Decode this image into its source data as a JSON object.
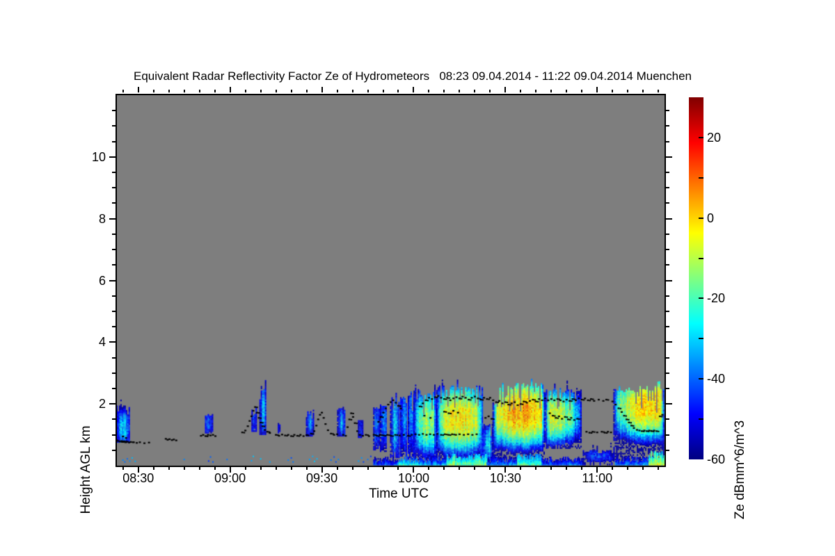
{
  "title": "Equivalent Radar Reflectivity Factor Ze of Hydrometeors   08:23 09.04.2014 - 11:22 09.04.2014 Muenchen",
  "chart_data": {
    "type": "heatmap",
    "title": "Equivalent Radar Reflectivity Factor Ze of Hydrometeors   08:23 09.04.2014 - 11:22 09.04.2014 Muenchen",
    "xlabel": "Time UTC",
    "ylabel": "Height AGL km",
    "time_start": "08:23",
    "time_end": "11:22",
    "x_minutes_total": 179,
    "x_major_ticks": [
      {
        "t": 7,
        "label": "08:30"
      },
      {
        "t": 37,
        "label": "09:00"
      },
      {
        "t": 67,
        "label": "09:30"
      },
      {
        "t": 97,
        "label": "10:00"
      },
      {
        "t": 127,
        "label": "10:30"
      },
      {
        "t": 157,
        "label": "11:00"
      }
    ],
    "x_minor_step_min": 5,
    "x_minor_offset_min": 2,
    "ylim_km": [
      0,
      12
    ],
    "y_major_ticks": [
      {
        "v": 2,
        "label": "2"
      },
      {
        "v": 4,
        "label": "4"
      },
      {
        "v": 6,
        "label": "6"
      },
      {
        "v": 8,
        "label": "8"
      },
      {
        "v": 10,
        "label": "10"
      }
    ],
    "y_minor_step_km": 0.5,
    "colors": {
      "no_data_gray": "#7e7e7e",
      "frame": "#000000",
      "cloud_base_dots": "#000000",
      "page_background": "#ffffff"
    },
    "colorbar": {
      "label": "Ze dBmm^6/m^3",
      "min": -60,
      "max": 30,
      "tick_labels": [
        20,
        0,
        -20,
        -40,
        -60
      ],
      "minor_ticks": [
        20,
        10,
        0,
        -10,
        -20,
        -30,
        -40,
        -50
      ],
      "colormap": "jet",
      "stops": [
        "#000080",
        "#0000ff",
        "#0080ff",
        "#00ffff",
        "#80ff80",
        "#ffff00",
        "#ff8000",
        "#ff0000",
        "#800000"
      ]
    },
    "echo_cells": [
      [
        0,
        4.5,
        0.75,
        1.95,
        -30,
        0.4,
        1.2
      ],
      [
        29,
        31.5,
        1.05,
        1.65,
        -38,
        0.5,
        1.35
      ],
      [
        44.2,
        45.6,
        1.1,
        1.9,
        -36,
        0.5,
        1.5
      ],
      [
        46.8,
        49,
        1.0,
        2.55,
        -27,
        0.45,
        1.8
      ],
      [
        52.8,
        53.6,
        1.05,
        1.4,
        -45,
        0.5,
        1.2
      ],
      [
        62,
        64.6,
        0.95,
        1.8,
        -33,
        0.5,
        1.35
      ],
      [
        72.2,
        74.8,
        0.95,
        1.85,
        -33,
        0.5,
        1.4
      ],
      [
        79,
        80.6,
        0.9,
        1.5,
        -43,
        0.5,
        1.2
      ],
      [
        84,
        86,
        0.5,
        1.9,
        -34,
        0.5,
        1.3
      ],
      [
        86.2,
        88.4,
        0.45,
        2.0,
        -29,
        0.5,
        1.4
      ],
      [
        89.5,
        92.4,
        0.25,
        2.2,
        -31,
        0.5,
        1.3
      ],
      [
        92.8,
        95,
        0.3,
        2.3,
        -28,
        0.5,
        1.5
      ],
      [
        95.3,
        97.2,
        0.2,
        2.4,
        -26,
        0.5,
        1.6
      ],
      [
        97.2,
        104.6,
        0.18,
        2.42,
        -14,
        0.6,
        1.4
      ],
      [
        104.6,
        119.6,
        0.15,
        2.6,
        -3,
        0.5,
        1.5
      ],
      [
        119.6,
        123,
        0.15,
        1.35,
        -28,
        0.5,
        0.7
      ],
      [
        123,
        140,
        0.13,
        2.66,
        4,
        0.55,
        1.7
      ],
      [
        140,
        152,
        0.55,
        2.5,
        -8,
        0.2,
        1.6
      ],
      [
        152.5,
        162.5,
        0.12,
        0.5,
        -42,
        0.5,
        0.3
      ],
      [
        162.5,
        179,
        0.18,
        2.56,
        0,
        0.68,
        1.9
      ]
    ],
    "surface_band": [
      [
        84,
        92,
        -34
      ],
      [
        92,
        99,
        -16
      ],
      [
        99,
        108,
        -26
      ],
      [
        108,
        121,
        -9
      ],
      [
        121,
        131,
        -30
      ],
      [
        131,
        139,
        -13
      ],
      [
        139,
        152,
        -32
      ],
      [
        152,
        163,
        -47
      ],
      [
        163,
        174,
        -30
      ],
      [
        174,
        179,
        -3
      ]
    ],
    "surface_speckles": [
      [
        2,
        0.18
      ],
      [
        2.6,
        0.12
      ],
      [
        3.4,
        0.22
      ],
      [
        4.2,
        0.15
      ],
      [
        5,
        0.25
      ],
      [
        6,
        0.14
      ],
      [
        22,
        0.2
      ],
      [
        30,
        0.15
      ],
      [
        30.6,
        0.28
      ],
      [
        31.4,
        0.12
      ],
      [
        36,
        0.2
      ],
      [
        44,
        0.16
      ],
      [
        44.6,
        0.3
      ],
      [
        47,
        0.22
      ],
      [
        50,
        0.12
      ],
      [
        56,
        0.18
      ],
      [
        57,
        0.25
      ],
      [
        57.6,
        0.12
      ],
      [
        63,
        0.2
      ],
      [
        64,
        0.3
      ],
      [
        64.6,
        0.14
      ],
      [
        65.4,
        0.22
      ],
      [
        70,
        0.18
      ],
      [
        71,
        0.28
      ],
      [
        71.6,
        0.12
      ],
      [
        72.4,
        0.2
      ],
      [
        79,
        0.15
      ],
      [
        80,
        0.25
      ],
      [
        80.6,
        0.12
      ],
      [
        82,
        0.2
      ],
      [
        83,
        0.3
      ]
    ],
    "cloud_base_points": [
      [
        0,
        0.82
      ],
      [
        0.5,
        0.8
      ],
      [
        1,
        0.78
      ],
      [
        1.5,
        0.8
      ],
      [
        2,
        0.77
      ],
      [
        2.5,
        0.79
      ],
      [
        3,
        0.76
      ],
      [
        3.5,
        0.78
      ],
      [
        4,
        0.75
      ],
      [
        4.5,
        0.77
      ],
      [
        5.5,
        0.76
      ],
      [
        6.5,
        0.74
      ],
      [
        7.5,
        0.76
      ],
      [
        9,
        0.73
      ],
      [
        10.5,
        0.75
      ],
      [
        2,
        0.95
      ],
      [
        3,
        0.9
      ],
      [
        16,
        0.87
      ],
      [
        16.6,
        0.84
      ],
      [
        17.2,
        0.86
      ],
      [
        18,
        0.83
      ],
      [
        18.6,
        0.85
      ],
      [
        19.4,
        0.82
      ],
      [
        27.5,
        0.97
      ],
      [
        28.2,
        1.0
      ],
      [
        29,
        0.96
      ],
      [
        29.8,
        1.0
      ],
      [
        30.6,
        0.98
      ],
      [
        31.4,
        1.0
      ],
      [
        32.2,
        0.96
      ],
      [
        41,
        1.08
      ],
      [
        42,
        1.14
      ],
      [
        42.8,
        1.28
      ],
      [
        43.4,
        1.45
      ],
      [
        44,
        1.6
      ],
      [
        44.6,
        1.78
      ],
      [
        45.2,
        1.9
      ],
      [
        45.8,
        1.72
      ],
      [
        46.4,
        1.55
      ],
      [
        47,
        1.4
      ],
      [
        47.6,
        1.28
      ],
      [
        48.4,
        1.16
      ],
      [
        49.2,
        1.1
      ],
      [
        50,
        1.06
      ],
      [
        52,
        1.0
      ],
      [
        53,
        0.97
      ],
      [
        54,
        1.01
      ],
      [
        55,
        0.98
      ],
      [
        56,
        1.0
      ],
      [
        57,
        0.96
      ],
      [
        58,
        1.0
      ],
      [
        59,
        0.97
      ],
      [
        60,
        1.0
      ],
      [
        61,
        0.96
      ],
      [
        62,
        0.99
      ],
      [
        63.5,
        1.04
      ],
      [
        64.5,
        1.12
      ],
      [
        65.2,
        1.3
      ],
      [
        65.8,
        1.5
      ],
      [
        66.4,
        1.65
      ],
      [
        67,
        1.72
      ],
      [
        67.6,
        1.55
      ],
      [
        68.2,
        1.35
      ],
      [
        69,
        1.15
      ],
      [
        70,
        1.04
      ],
      [
        71,
        1.0
      ],
      [
        72,
        1.02
      ],
      [
        74,
        1.0
      ],
      [
        74.8,
        0.97
      ],
      [
        75.4,
        1.25
      ],
      [
        76,
        1.5
      ],
      [
        76.6,
        1.7
      ],
      [
        77.2,
        1.58
      ],
      [
        77.8,
        1.38
      ],
      [
        78.6,
        1.12
      ],
      [
        79.4,
        1.0
      ],
      [
        80.4,
        0.97
      ],
      [
        81.4,
        1.0
      ],
      [
        82.4,
        0.96
      ],
      [
        84,
        1.0
      ],
      [
        85,
        0.97
      ],
      [
        86,
        1.0
      ],
      [
        87.2,
        0.98
      ],
      [
        88.4,
        1.0
      ],
      [
        89.6,
        0.97
      ],
      [
        91,
        1.0
      ],
      [
        92.4,
        0.98
      ],
      [
        93.8,
        1.0
      ],
      [
        95.2,
        0.97
      ],
      [
        96.4,
        1.0
      ],
      [
        85.5,
        1.42
      ],
      [
        86.3,
        1.58
      ],
      [
        87.1,
        1.72
      ],
      [
        87.9,
        1.86
      ],
      [
        88.7,
        1.98
      ],
      [
        89.5,
        2.06
      ],
      [
        90.3,
        2.12
      ],
      [
        91.2,
        2.04
      ],
      [
        92,
        1.94
      ],
      [
        92.8,
        1.85
      ],
      [
        97.6,
        1.02
      ],
      [
        98.8,
        1.0
      ],
      [
        100,
        1.03
      ],
      [
        101.2,
        1.0
      ],
      [
        102.4,
        1.02
      ],
      [
        103.6,
        1.0
      ],
      [
        104.8,
        1.03
      ],
      [
        106,
        1.0
      ],
      [
        107.2,
        1.02
      ],
      [
        108.4,
        1.0
      ],
      [
        109.6,
        1.02
      ],
      [
        110.8,
        1.0
      ],
      [
        112,
        1.02
      ],
      [
        113.4,
        1.0
      ],
      [
        114.8,
        1.02
      ],
      [
        116.2,
        1.0
      ],
      [
        117.6,
        1.02
      ],
      [
        99,
        1.92
      ],
      [
        100,
        2.02
      ],
      [
        101,
        2.12
      ],
      [
        102,
        2.2
      ],
      [
        103,
        2.16
      ],
      [
        104,
        2.22
      ],
      [
        105,
        2.26
      ],
      [
        106,
        2.2
      ],
      [
        107,
        2.16
      ],
      [
        108,
        2.2
      ],
      [
        109,
        2.12
      ],
      [
        110,
        2.18
      ],
      [
        111,
        2.22
      ],
      [
        112,
        2.18
      ],
      [
        113,
        2.24
      ],
      [
        114,
        2.2
      ],
      [
        115,
        2.14
      ],
      [
        116,
        2.2
      ],
      [
        117,
        2.24
      ],
      [
        118,
        2.18
      ],
      [
        119,
        2.14
      ],
      [
        120,
        2.2
      ],
      [
        121,
        2.16
      ],
      [
        122,
        2.2
      ],
      [
        100.5,
        1.62
      ],
      [
        102.5,
        1.55
      ],
      [
        107,
        1.75
      ],
      [
        108.5,
        1.7
      ],
      [
        110,
        1.78
      ],
      [
        111.5,
        1.72
      ],
      [
        120.5,
        1.55
      ],
      [
        121.5,
        1.6
      ],
      [
        122.5,
        1.52
      ],
      [
        123,
        2.12
      ],
      [
        124,
        2.06
      ],
      [
        125,
        2.1
      ],
      [
        126,
        2.02
      ],
      [
        127,
        2.06
      ],
      [
        128,
        1.98
      ],
      [
        129,
        2.02
      ],
      [
        130,
        2.06
      ],
      [
        131,
        1.96
      ],
      [
        132,
        2.0
      ],
      [
        133,
        2.08
      ],
      [
        134,
        2.04
      ],
      [
        135,
        2.1
      ],
      [
        136,
        2.14
      ],
      [
        137,
        2.08
      ],
      [
        138,
        2.16
      ],
      [
        139,
        2.12
      ],
      [
        140,
        2.18
      ],
      [
        141,
        2.12
      ],
      [
        142,
        2.16
      ],
      [
        143,
        2.12
      ],
      [
        144,
        2.16
      ],
      [
        145,
        2.12
      ],
      [
        146,
        2.08
      ],
      [
        147,
        2.14
      ],
      [
        148,
        2.1
      ],
      [
        149,
        2.16
      ],
      [
        150,
        2.12
      ],
      [
        151,
        2.18
      ],
      [
        141.5,
        1.7
      ],
      [
        142.5,
        1.62
      ],
      [
        143.5,
        1.55
      ],
      [
        144.5,
        1.6
      ],
      [
        145.5,
        1.52
      ],
      [
        146.5,
        1.58
      ],
      [
        147.5,
        1.5
      ],
      [
        148.5,
        1.55
      ],
      [
        149.5,
        1.48
      ],
      [
        150.5,
        1.52
      ],
      [
        153.5,
        1.1
      ],
      [
        154.5,
        1.07
      ],
      [
        155.5,
        1.1
      ],
      [
        157,
        1.08
      ],
      [
        158.5,
        1.1
      ],
      [
        159.5,
        1.07
      ],
      [
        160.5,
        1.1
      ],
      [
        161.5,
        1.08
      ],
      [
        152,
        2.14
      ],
      [
        153,
        2.18
      ],
      [
        154,
        2.12
      ],
      [
        155,
        2.16
      ],
      [
        156,
        2.1
      ],
      [
        157.5,
        2.14
      ],
      [
        159,
        2.1
      ],
      [
        160,
        2.14
      ],
      [
        162,
        2.08
      ],
      [
        163,
        1.98
      ],
      [
        164,
        1.86
      ],
      [
        165,
        1.74
      ],
      [
        165.8,
        1.62
      ],
      [
        166.6,
        1.5
      ],
      [
        167.4,
        1.4
      ],
      [
        168.2,
        1.3
      ],
      [
        169,
        1.22
      ],
      [
        170,
        1.16
      ],
      [
        170.8,
        1.14
      ],
      [
        171.6,
        1.12
      ],
      [
        172.4,
        1.14
      ],
      [
        173.2,
        1.12
      ],
      [
        174,
        1.14
      ],
      [
        174.8,
        1.12
      ],
      [
        175.6,
        1.14
      ],
      [
        176.4,
        1.12
      ],
      [
        177.5,
        1.6
      ],
      [
        178.3,
        1.65
      ]
    ]
  }
}
